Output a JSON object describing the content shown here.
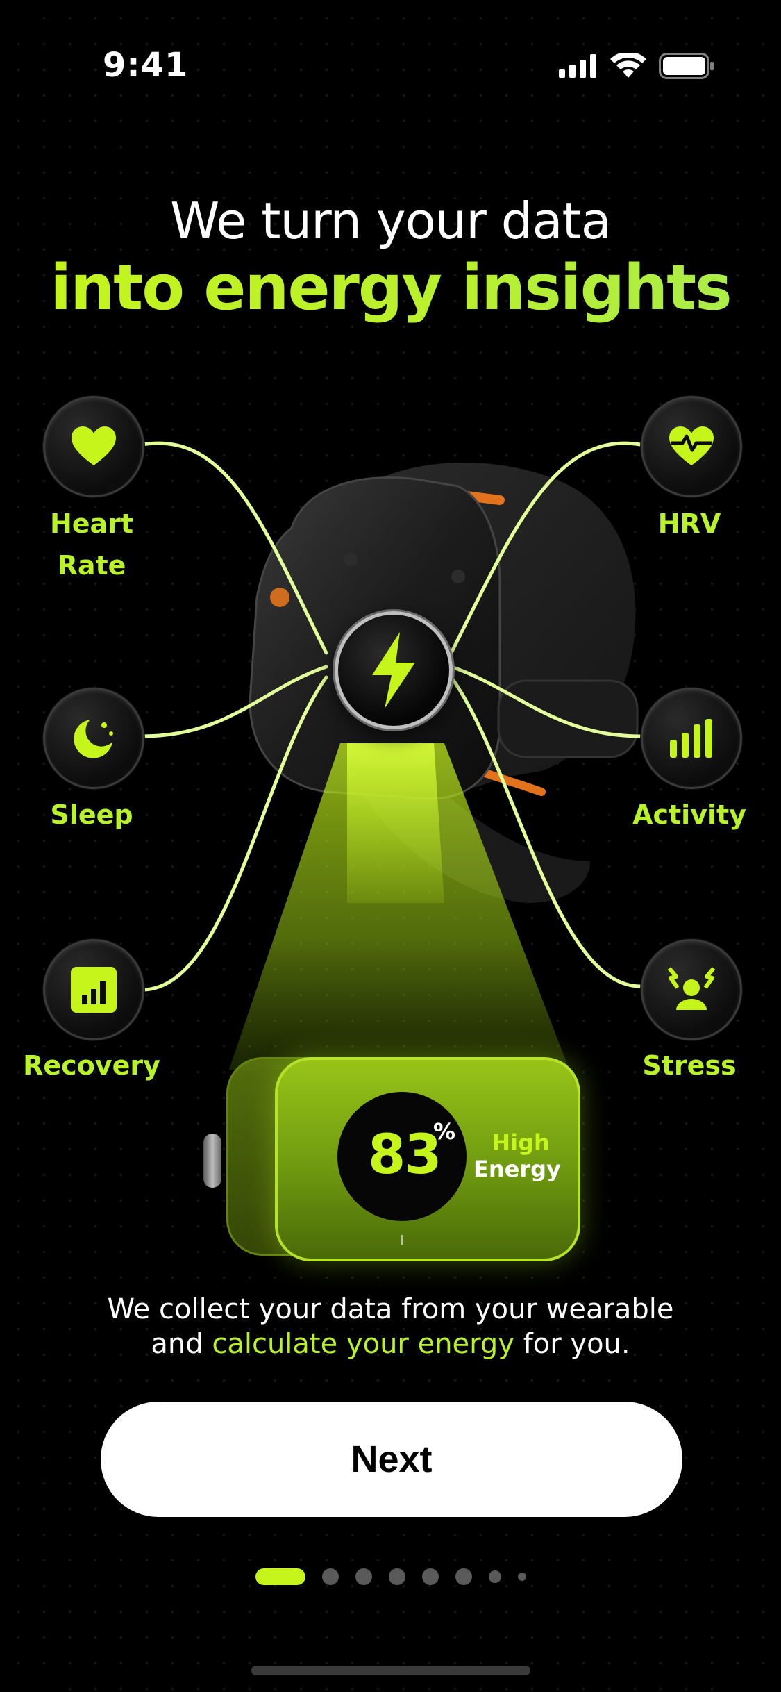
{
  "status_bar": {
    "time": "9:41"
  },
  "headline": {
    "line1": "We turn your data",
    "line2": "into energy insights"
  },
  "metrics": {
    "heart_rate": {
      "label_line1": "Heart",
      "label_line2": "Rate",
      "icon": "heart-icon"
    },
    "sleep": {
      "label": "Sleep",
      "icon": "moon-icon"
    },
    "recovery": {
      "label": "Recovery",
      "icon": "bar-chart-icon"
    },
    "hrv": {
      "label": "HRV",
      "icon": "heart-pulse-icon"
    },
    "activity": {
      "label": "Activity",
      "icon": "activity-bars-icon"
    },
    "stress": {
      "label": "Stress",
      "icon": "stress-icon"
    }
  },
  "energy_card": {
    "value": "83",
    "unit": "%",
    "label_line1": "High",
    "label_line2": "Energy"
  },
  "description": {
    "part1": "We collect your data from your wearable",
    "part2": "and ",
    "highlight": "calculate your energy",
    "part3": " for you."
  },
  "next_button": {
    "label": "Next"
  },
  "pager": {
    "pages": 8,
    "current": 1
  },
  "colors": {
    "accent": "#c6f51b",
    "background": "#000000",
    "button": "#ffffff"
  }
}
